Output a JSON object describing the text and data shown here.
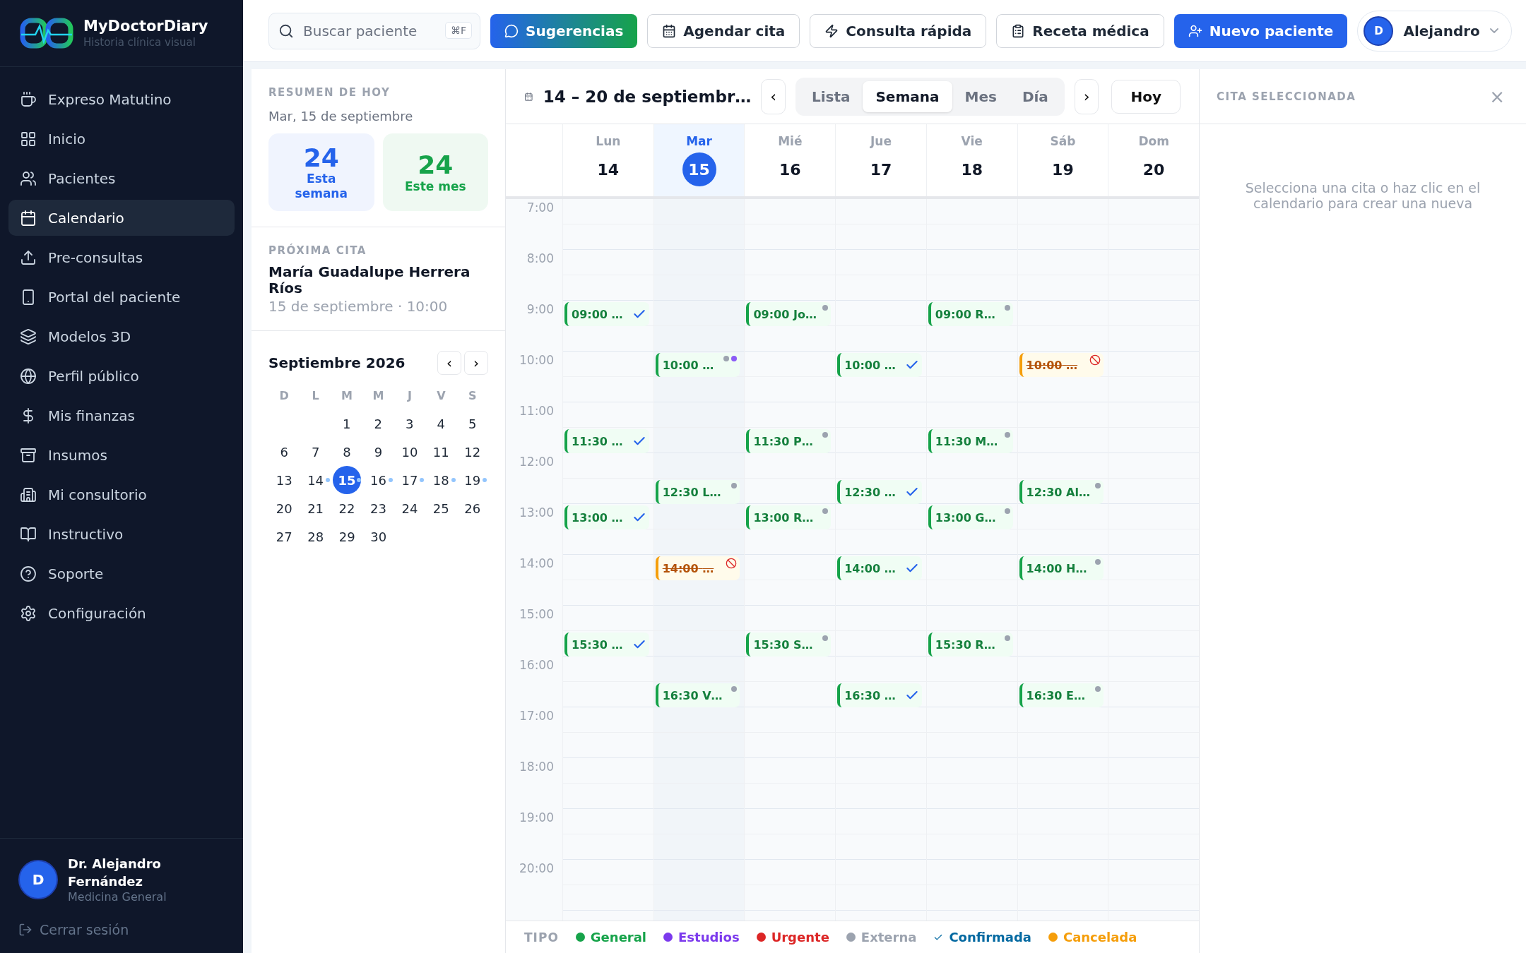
{
  "brand": {
    "name": "MyDoctorDiary",
    "tagline": "Historia clínica visual"
  },
  "sidebar": {
    "items": [
      {
        "label": "Expreso Matutino",
        "selected": false
      },
      {
        "label": "Inicio",
        "selected": false
      },
      {
        "label": "Pacientes",
        "selected": false
      },
      {
        "label": "Calendario",
        "selected": true
      },
      {
        "label": "Pre-consultas",
        "selected": false
      },
      {
        "label": "Portal del paciente",
        "selected": false
      },
      {
        "label": "Modelos 3D",
        "selected": false
      },
      {
        "label": "Perfil público",
        "selected": false
      },
      {
        "label": "Mis finanzas",
        "selected": false
      },
      {
        "label": "Insumos",
        "selected": false
      },
      {
        "label": "Mi consultorio",
        "selected": false
      },
      {
        "label": "Instructivo",
        "selected": false
      },
      {
        "label": "Soporte",
        "selected": false
      },
      {
        "label": "Configuración",
        "selected": false
      }
    ],
    "user": {
      "initial": "D",
      "name": "Dr. Alejandro Fernández",
      "role": "Medicina General"
    },
    "logout": "Cerrar sesión"
  },
  "topbar": {
    "search": {
      "placeholder": "Buscar paciente",
      "shortcut": "⌘F"
    },
    "buttons": [
      {
        "label": "Sugerencias",
        "kind": "gradient"
      },
      {
        "label": "Agendar cita",
        "kind": "outline"
      },
      {
        "label": "Consulta rápida",
        "kind": "outline"
      },
      {
        "label": "Receta médica",
        "kind": "outline"
      },
      {
        "label": "Nuevo paciente",
        "kind": "primary"
      }
    ],
    "user": {
      "initial": "D",
      "name": "Alejandro"
    }
  },
  "summary": {
    "title": "RESUMEN DE HOY",
    "date": "Mar, 15 de septiembre",
    "stats": [
      {
        "value": "24",
        "label": "Esta semana",
        "color": "#2563eb"
      },
      {
        "value": "24",
        "label": "Este mes",
        "color": "#16a34a"
      }
    ]
  },
  "next": {
    "title": "PRÓXIMA CITA",
    "patient": "María Guadalupe Herrera Ríos",
    "when": "15 de septiembre · 10:00"
  },
  "mini_calendar": {
    "title": "Septiembre 2026",
    "prev": "‹",
    "next": "›",
    "weekdays": [
      "D",
      "L",
      "M",
      "M",
      "J",
      "V",
      "S"
    ],
    "weeks": [
      [
        {
          "day": "1",
          "selected": false,
          "dot": false
        },
        {
          "day": "2",
          "selected": false,
          "dot": false
        },
        {
          "day": "3",
          "selected": false,
          "dot": false
        },
        {
          "day": "4",
          "selected": false,
          "dot": false
        },
        {
          "day": "5",
          "selected": false,
          "dot": false
        }
      ],
      [
        {
          "day": "6",
          "selected": false,
          "dot": false
        },
        {
          "day": "7",
          "selected": false,
          "dot": false
        },
        {
          "day": "8",
          "selected": false,
          "dot": false
        },
        {
          "day": "9",
          "selected": false,
          "dot": false
        },
        {
          "day": "10",
          "selected": false,
          "dot": false
        },
        {
          "day": "11",
          "selected": false,
          "dot": false
        },
        {
          "day": "12",
          "selected": false,
          "dot": false
        }
      ],
      [
        {
          "day": "13",
          "selected": false,
          "dot": false
        },
        {
          "day": "14",
          "selected": false,
          "dot": true
        },
        {
          "day": "15",
          "selected": true,
          "dot": true
        },
        {
          "day": "16",
          "selected": false,
          "dot": true
        },
        {
          "day": "17",
          "selected": false,
          "dot": true
        },
        {
          "day": "18",
          "selected": false,
          "dot": true
        },
        {
          "day": "19",
          "selected": false,
          "dot": true
        }
      ],
      [
        {
          "day": "20",
          "selected": false,
          "dot": false
        },
        {
          "day": "21",
          "selected": false,
          "dot": false
        },
        {
          "day": "22",
          "selected": false,
          "dot": false
        },
        {
          "day": "23",
          "selected": false,
          "dot": false
        },
        {
          "day": "24",
          "selected": false,
          "dot": false
        },
        {
          "day": "25",
          "selected": false,
          "dot": false
        },
        {
          "day": "26",
          "selected": false,
          "dot": false
        }
      ],
      [
        {
          "day": "27",
          "selected": false,
          "dot": false
        },
        {
          "day": "28",
          "selected": false,
          "dot": false
        },
        {
          "day": "29",
          "selected": false,
          "dot": false
        },
        {
          "day": "30",
          "selected": false,
          "dot": false
        }
      ]
    ]
  },
  "calendar": {
    "range": "14 – 20 de septiembr…",
    "prev": "‹",
    "next": "›",
    "today": "Hoy",
    "views": [
      {
        "label": "Lista",
        "selected": false
      },
      {
        "label": "Semana",
        "selected": true
      },
      {
        "label": "Mes",
        "selected": false
      },
      {
        "label": "Día",
        "selected": false
      }
    ],
    "hours": [
      "7:00",
      "8:00",
      "9:00",
      "10:00",
      "11:00",
      "12:00",
      "13:00",
      "14:00",
      "15:00",
      "16:00",
      "17:00",
      "18:00",
      "19:00",
      "20:00"
    ],
    "days": [
      {
        "name": "Lun",
        "number": "14",
        "selected": false,
        "events": [
          {
            "time": "09:00",
            "title": "…",
            "kind": "general",
            "confirmed": true
          },
          {
            "time": "11:30",
            "title": "…",
            "kind": "general",
            "confirmed": true
          },
          {
            "time": "13:00",
            "title": "…",
            "kind": "general",
            "confirmed": true
          },
          {
            "time": "15:30",
            "title": "…",
            "kind": "general",
            "confirmed": true
          }
        ]
      },
      {
        "name": "Mar",
        "number": "15",
        "selected": true,
        "events": [
          {
            "time": "10:00",
            "title": "…",
            "kind": "general",
            "confirmed": false,
            "tags": [
              {
                "color": "#9ca3af"
              },
              {
                "color": "#8b5cf6"
              }
            ]
          },
          {
            "time": "12:30",
            "title": "L…",
            "kind": "general",
            "confirmed": false,
            "tags": [
              {
                "color": "#9ca3af"
              }
            ]
          },
          {
            "time": "14:00",
            "title": "…",
            "kind": "cancelled",
            "confirmed": false
          },
          {
            "time": "16:30",
            "title": "V…",
            "kind": "general",
            "confirmed": false,
            "tags": [
              {
                "color": "#9ca3af"
              }
            ]
          }
        ]
      },
      {
        "name": "Mié",
        "number": "16",
        "selected": false,
        "events": [
          {
            "time": "09:00",
            "title": "Jo…",
            "kind": "general",
            "confirmed": false,
            "tags": [
              {
                "color": "#9ca3af"
              }
            ]
          },
          {
            "time": "11:30",
            "title": "P…",
            "kind": "general",
            "confirmed": false,
            "tags": [
              {
                "color": "#9ca3af"
              }
            ]
          },
          {
            "time": "13:00",
            "title": "R…",
            "kind": "general",
            "confirmed": false,
            "tags": [
              {
                "color": "#9ca3af"
              }
            ]
          },
          {
            "time": "15:30",
            "title": "S…",
            "kind": "general",
            "confirmed": false,
            "tags": [
              {
                "color": "#9ca3af"
              }
            ]
          }
        ]
      },
      {
        "name": "Jue",
        "number": "17",
        "selected": false,
        "events": [
          {
            "time": "10:00",
            "title": "…",
            "kind": "general",
            "confirmed": true
          },
          {
            "time": "12:30",
            "title": "…",
            "kind": "general",
            "confirmed": true
          },
          {
            "time": "14:00",
            "title": "…",
            "kind": "general",
            "confirmed": true
          },
          {
            "time": "16:30",
            "title": "…",
            "kind": "general",
            "confirmed": true
          }
        ]
      },
      {
        "name": "Vie",
        "number": "18",
        "selected": false,
        "events": [
          {
            "time": "09:00",
            "title": "R…",
            "kind": "general",
            "confirmed": false,
            "tags": [
              {
                "color": "#9ca3af"
              }
            ]
          },
          {
            "time": "11:30",
            "title": "M…",
            "kind": "general",
            "confirmed": false,
            "tags": [
              {
                "color": "#9ca3af"
              }
            ]
          },
          {
            "time": "13:00",
            "title": "G…",
            "kind": "general",
            "confirmed": false,
            "tags": [
              {
                "color": "#9ca3af"
              }
            ]
          },
          {
            "time": "15:30",
            "title": "R…",
            "kind": "general",
            "confirmed": false,
            "tags": [
              {
                "color": "#9ca3af"
              }
            ]
          }
        ]
      },
      {
        "name": "Sáb",
        "number": "19",
        "selected": false,
        "events": [
          {
            "time": "10:00",
            "title": "…",
            "kind": "cancelled",
            "confirmed": false
          },
          {
            "time": "12:30",
            "title": "Al…",
            "kind": "general",
            "confirmed": false,
            "tags": [
              {
                "color": "#9ca3af"
              }
            ]
          },
          {
            "time": "14:00",
            "title": "H…",
            "kind": "general",
            "confirmed": false,
            "tags": [
              {
                "color": "#9ca3af"
              }
            ]
          },
          {
            "time": "16:30",
            "title": "E…",
            "kind": "general",
            "confirmed": false,
            "tags": [
              {
                "color": "#9ca3af"
              }
            ]
          }
        ]
      },
      {
        "name": "Dom",
        "number": "20",
        "selected": false
      }
    ],
    "legend": {
      "title": "TIPO",
      "items": [
        {
          "label": "General",
          "kind": "dot",
          "color": "#16a34a"
        },
        {
          "label": "Estudios",
          "kind": "dot",
          "color": "#7c3aed"
        },
        {
          "label": "Urgente",
          "kind": "dot",
          "color": "#dc2626"
        },
        {
          "label": "Externa",
          "kind": "dot",
          "color": "#9ca3af"
        },
        {
          "label": "Confirmada",
          "kind": "check",
          "color": "#0369a1"
        },
        {
          "label": "Cancelada",
          "kind": "dot",
          "color": "#f59e0b"
        }
      ]
    }
  },
  "detail": {
    "title": "CITA SELECCIONADA",
    "close": "×",
    "empty": "Selecciona una cita o haz clic en el calendario para crear una nueva"
  }
}
